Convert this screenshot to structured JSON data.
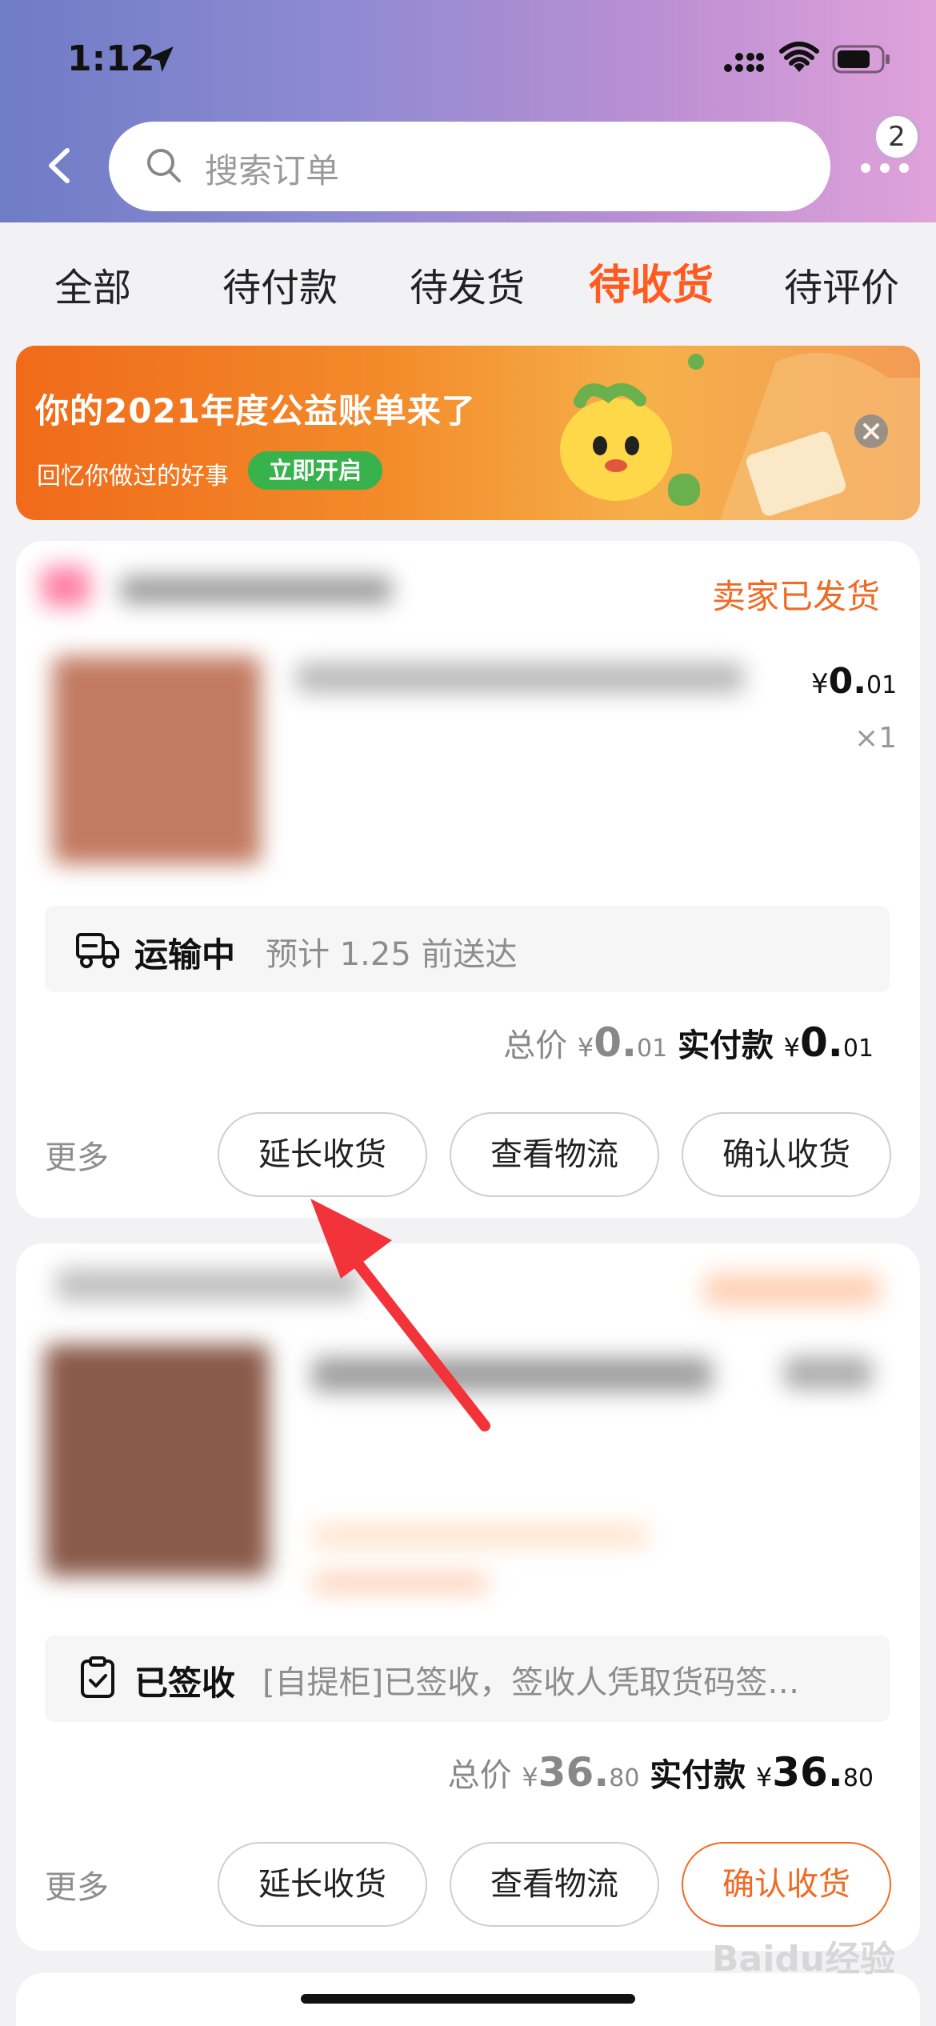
{
  "status_bar": {
    "time": "1:12"
  },
  "header": {
    "search_placeholder": "搜索订单",
    "badge_count": "2"
  },
  "tabs": [
    "全部",
    "待付款",
    "待发货",
    "待收货",
    "待评价"
  ],
  "active_tab": "待收货",
  "banner": {
    "title": "你的2021年度公益账单来了",
    "subtitle": "回忆你做过的好事",
    "button": "立即开启"
  },
  "orders": [
    {
      "status": "卖家已发货",
      "price_yen": "¥",
      "price_int": "0.",
      "price_dec": "01",
      "quantity": "×1",
      "logistics_status": "运输中",
      "logistics_desc": "预计 1.25 前送达",
      "total_label": "总价",
      "total_int": "0.",
      "total_dec": "01",
      "paid_label": "实付款",
      "paid_int": "0.",
      "paid_dec": "01",
      "more": "更多",
      "buttons": [
        "延长收货",
        "查看物流",
        "确认收货"
      ]
    },
    {
      "logistics_status": "已签收",
      "logistics_desc": "[自提柜]已签收，签收人凭取货码签…",
      "total_label": "总价",
      "total_int": "36.",
      "total_dec": "80",
      "paid_label": "实付款",
      "paid_int": "36.",
      "paid_dec": "80",
      "more": "更多",
      "buttons": [
        "延长收货",
        "查看物流",
        "确认收货"
      ]
    }
  ],
  "watermark": "Baidu经验",
  "colors": {
    "accent": "#f06a23",
    "active_tab": "#ff5a1f",
    "annotation_arrow": "#f2333a"
  }
}
